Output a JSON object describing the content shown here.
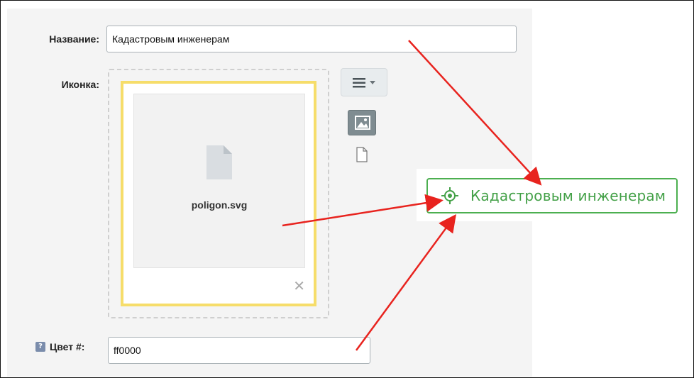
{
  "form": {
    "name_label": "Название:",
    "name_value": "Кадастровым инженерам",
    "icon_label": "Иконка:",
    "file_name": "poligon.svg",
    "remove_glyph": "✕",
    "color_help_glyph": "?",
    "color_label": "Цвет #:",
    "color_value": "ff0000"
  },
  "toolbar": {
    "menu_icon": "menu-dropdown-icon",
    "image_icon": "image-icon",
    "file_icon": "file-icon"
  },
  "badge": {
    "text": "Кадастровым инженерам",
    "icon": "target-crosshair-icon",
    "color": "#43a047"
  },
  "annotation": {
    "arrow_color": "#e8231e"
  }
}
